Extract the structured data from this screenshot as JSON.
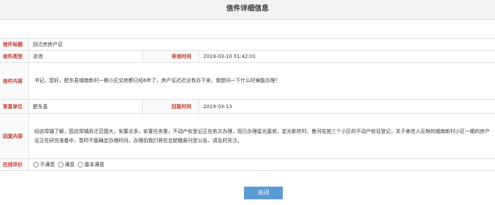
{
  "page_title": "信件详细信息",
  "rows": {
    "subject": {
      "label": "信件标题",
      "value": "回迁房房产证"
    },
    "type": {
      "label": "信件类型",
      "value": "咨询",
      "time_label": "来信时间",
      "time_value": "2019-03-10 01:42:01"
    },
    "content": {
      "label": "信件内容",
      "value": "书记，您好，肥东县城南新村一期小区交房都已经6年了，房产证迟迟没有办下来，我想问一下什么时候能办理？"
    },
    "reply_unit": {
      "label": "答复单位",
      "value": "肥东县",
      "time_label": "回复时间",
      "time_value": "2019-03-13"
    },
    "reply_content": {
      "label": "回复内容",
      "value": "经店埠镇了解，因店埠镇拆迁范围大，安置点多，安置任务重，不动产权登记正在依次办理，现已办理星光嘉苑、定光新农村、曼河花苑三个小区的不动产权证登记，关于来信人反映的城南新村小区一期的房产证正在研究准备中，暂时不能确定办理时间，办理前我们将在合肥晚报刊登公告，请及时关注。"
    },
    "rating": {
      "label": "在线评价",
      "options": [
        "不满意",
        "满意",
        "基本满意"
      ]
    }
  },
  "close_button": "关闭"
}
